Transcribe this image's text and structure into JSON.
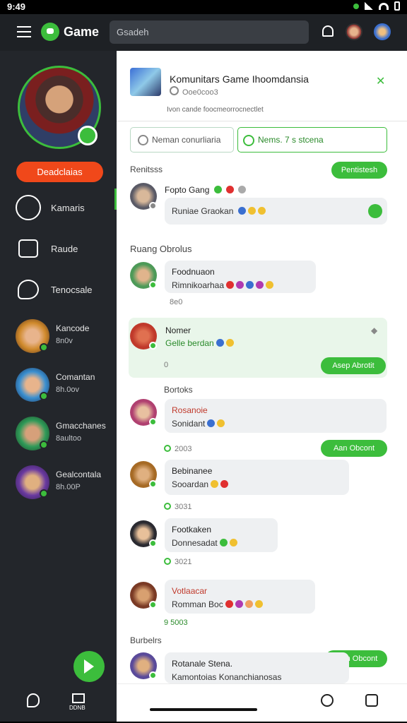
{
  "status": {
    "time": "9:49"
  },
  "appbar": {
    "brand": "Game",
    "search_placeholder": "Gsadeh"
  },
  "sidebar": {
    "profile_button": "Deadclaias",
    "nav": [
      {
        "label": "Kamaris",
        "icon": "gamepad-icon"
      },
      {
        "label": "Raude",
        "icon": "calendar-icon"
      },
      {
        "label": "Tenocsale",
        "icon": "chat-bubble-icon"
      }
    ],
    "friends": [
      {
        "name": "Kancode",
        "status": "8n0v",
        "color": "#d08a2c"
      },
      {
        "name": "Comantan",
        "status": "8h.0ov",
        "color": "#3a8fd0"
      },
      {
        "name": "Gmacchanes",
        "status": "8aultoo",
        "color": "#2f9a58"
      },
      {
        "name": "Gealcontala",
        "status": "8h.00P",
        "color": "#6a3aa0"
      }
    ],
    "bottom_label": "DDNB"
  },
  "group": {
    "title": "Komunitars Game Ihoomdansia",
    "subtitle": "Ooe0coo3",
    "description": "Ivon cande foocmeorrocnectlet",
    "search1_placeholder": "Neman conurliaria",
    "search2_value": "Nems. 7 s stcena"
  },
  "sections": {
    "pinned": "Renitsss",
    "pinned_button": "Pentistesh",
    "chat_room": "Ruang Obrolus",
    "bottom_section": "Bortoks",
    "bottom2": "Burbelrs",
    "accept_button": "Asep Abrotit",
    "join_button": "Aan Obcont",
    "join_button2": "Pian Obcont"
  },
  "pinned_msg": {
    "name": "Fopto Gang",
    "text": "Runiae Graokan"
  },
  "messages": [
    {
      "name": "Foodnuaon",
      "text": "Rimnikoarhaa",
      "meta": "8e0",
      "color": "#4d9a58"
    },
    {
      "name": "Nomer",
      "text": "Gelle berdan",
      "meta": "0",
      "color": "#c0392b"
    },
    {
      "name": "Rosanoie",
      "text": "Sonidant",
      "meta": "",
      "color": "#b04070"
    },
    {
      "name": "Bebinanee",
      "text": "Sooardan",
      "meta": "2003",
      "color": "#a66a25"
    },
    {
      "name": "Footkaken",
      "text": "Donnesadat",
      "meta": "3031",
      "color": "#2a2a30"
    },
    {
      "name": "Votlaacar",
      "text": "Romman Boc",
      "meta": "3021",
      "color": "#7a3a25"
    },
    {
      "name": "Rotanale Stena.",
      "text": "Kamontoias Konanchianosas",
      "meta": "9 5003",
      "color": "#5a4a9a"
    }
  ]
}
